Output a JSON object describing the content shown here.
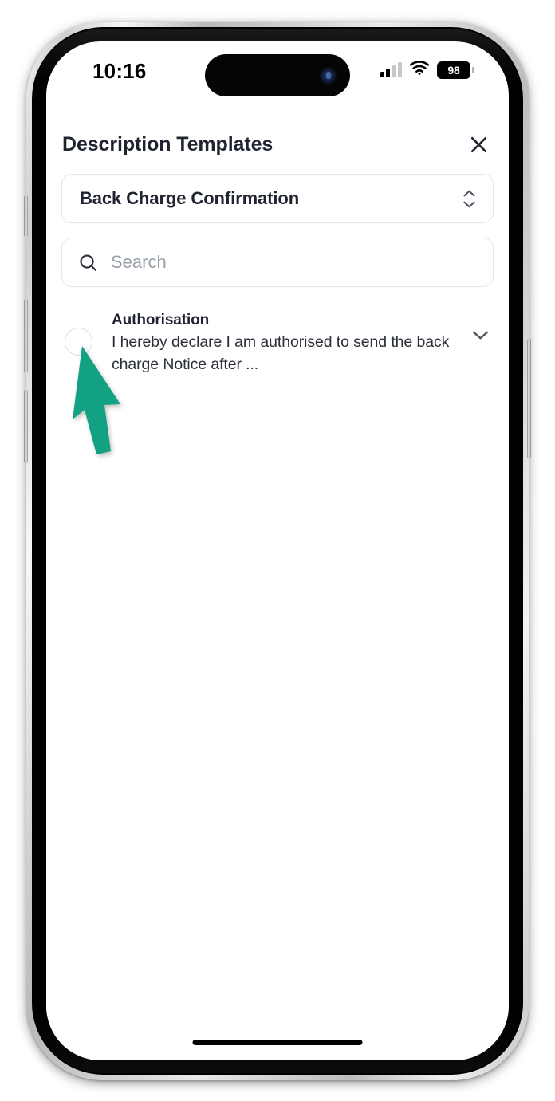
{
  "status_bar": {
    "time": "10:16",
    "battery_level": "98",
    "signal_icon": "cellular-bars-icon",
    "wifi_icon": "wifi-icon",
    "battery_icon": "battery-icon"
  },
  "header": {
    "title": "Description Templates",
    "close_icon": "close-icon"
  },
  "template_select": {
    "value": "Back Charge Confirmation",
    "indicator_icon": "chevron-up-down-icon"
  },
  "search": {
    "placeholder": "Search",
    "value": "",
    "icon": "search-icon"
  },
  "list": {
    "items": [
      {
        "title": "Authorisation",
        "description": "I hereby declare I am authorised to send the back charge Notice after ...",
        "selected": false,
        "radio_icon": "radio-unchecked-icon",
        "expand_icon": "chevron-down-icon"
      }
    ]
  },
  "annotation": {
    "cursor_icon": "cursor-arrow-icon",
    "color": "#12A183",
    "points_at": "radio-unchecked-icon"
  },
  "colors": {
    "accent": "#12A183",
    "text_primary": "#1F2430",
    "text_muted": "#9AA0AA",
    "border": "#E3E5E9",
    "divider": "#ECECEE",
    "screen_background": "#FFFFFF"
  }
}
